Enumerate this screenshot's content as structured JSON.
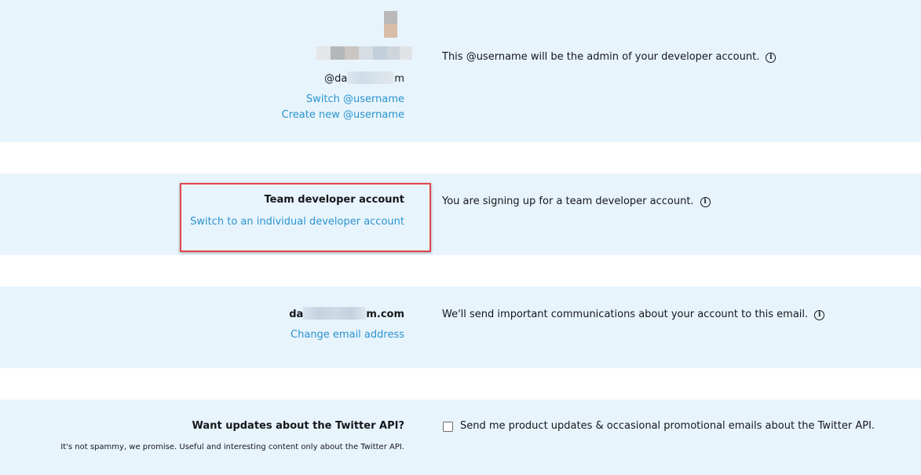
{
  "account": {
    "username_prefix": "@da",
    "username_suffix": "m",
    "switch_username": "Switch @username",
    "create_username": "Create new @username",
    "admin_note": "This @username will be the admin of your developer account."
  },
  "team": {
    "title": "Team developer account",
    "switch_link": "Switch to an individual developer account",
    "note": "You are signing up for a team developer account."
  },
  "email": {
    "prefix": "da",
    "suffix": "m.com",
    "change_link": "Change email address",
    "note": "We'll send important communications about your account to this email."
  },
  "updates": {
    "title": "Want updates about the Twitter API?",
    "subtitle": "It's not spammy, we promise. Useful and interesting content only about the Twitter API.",
    "checkbox_label": "Send me product updates & occasional promotional emails about the Twitter API.",
    "checked": false
  },
  "icons": {
    "info": "info-icon",
    "info_glyph": "i"
  },
  "colors": {
    "band_bg": "#e8f4fc",
    "link": "#2a93cf",
    "highlight": "#e0474c"
  }
}
